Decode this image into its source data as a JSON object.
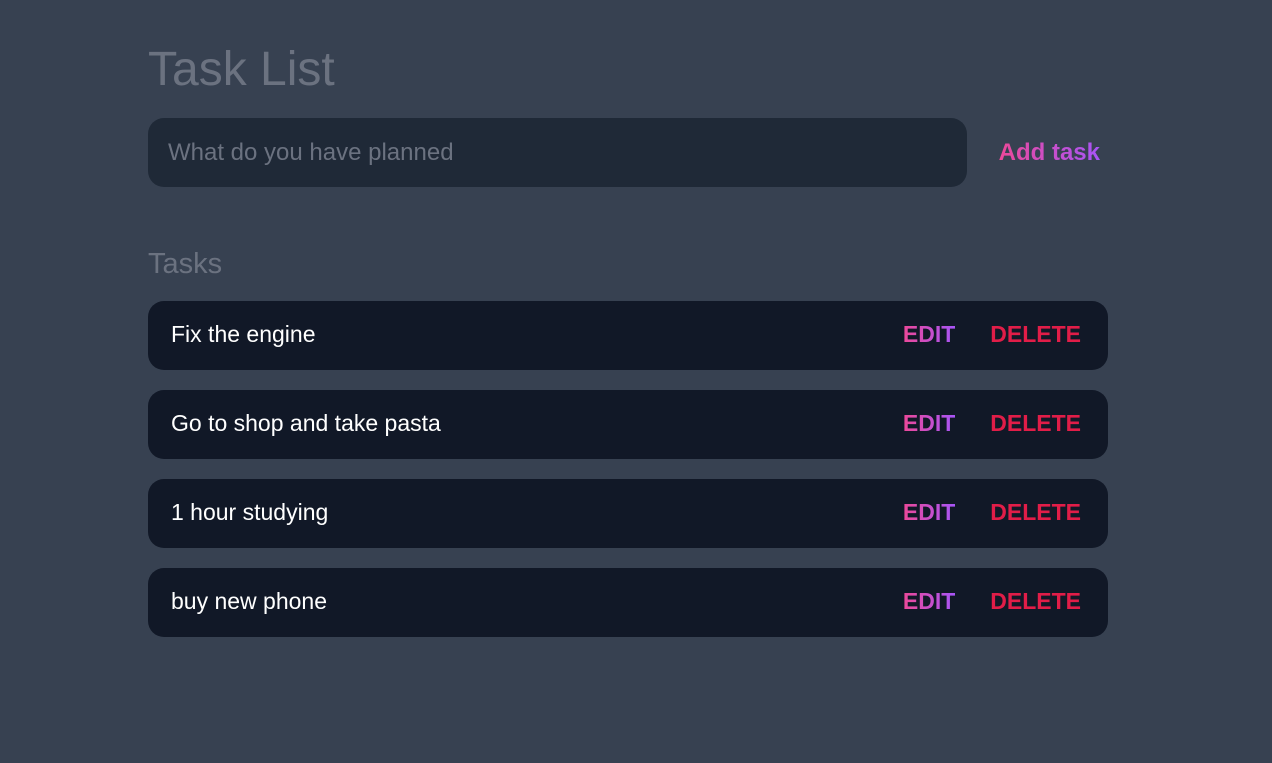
{
  "header": {
    "title": "Task List"
  },
  "add_form": {
    "placeholder": "What do you have planned",
    "value": "",
    "add_label": "Add task"
  },
  "tasks_section": {
    "title": "Tasks",
    "edit_label": "EDIT",
    "delete_label": "DELETE",
    "items": [
      {
        "text": "Fix the engine"
      },
      {
        "text": "Go to shop and take pasta"
      },
      {
        "text": "1 hour studying"
      },
      {
        "text": "buy new phone"
      }
    ]
  },
  "colors": {
    "background": "#374151",
    "input_background": "#1f2937",
    "task_background": "#111827",
    "muted_text": "#6b7280",
    "accent_gradient_start": "#ec4899",
    "accent_gradient_end": "#a855f7",
    "delete_color": "#e11d48"
  }
}
